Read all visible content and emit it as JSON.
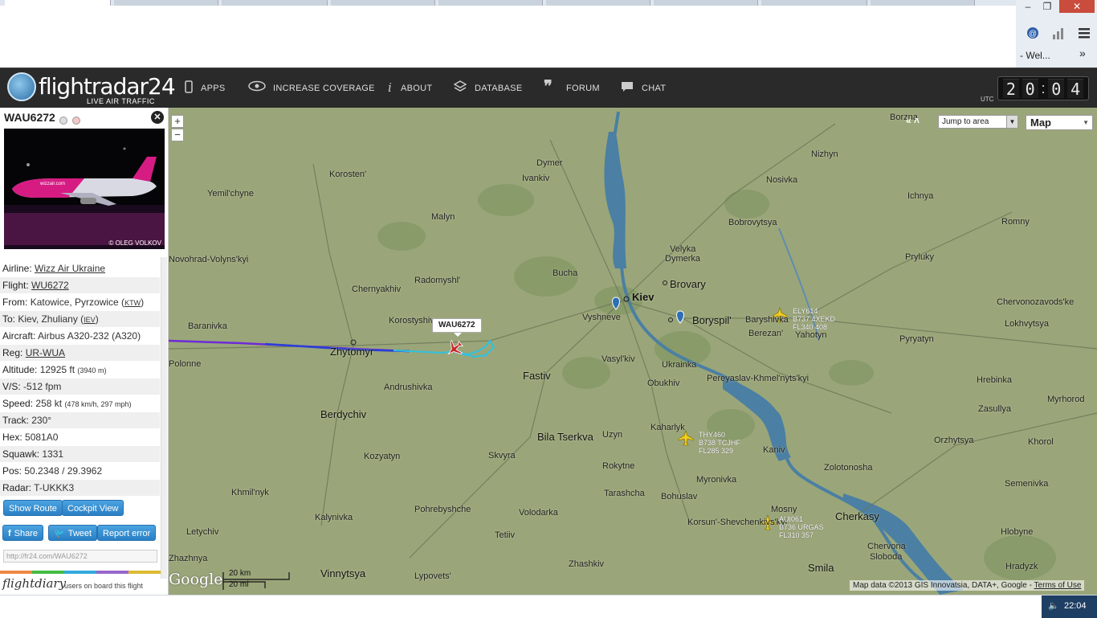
{
  "browser": {
    "bookmark_text": "- Wel...",
    "more": "»",
    "win_min": "–",
    "win_restore": "❐",
    "win_close": "✕"
  },
  "header": {
    "logo": "flightradar24",
    "tagline": "LIVE AIR TRAFFIC",
    "nav": [
      {
        "label": "APPS",
        "icon": "phone-icon"
      },
      {
        "label": "INCREASE COVERAGE",
        "icon": "eye-icon"
      },
      {
        "label": "ABOUT",
        "icon": "info-icon"
      },
      {
        "label": "DATABASE",
        "icon": "database-icon"
      },
      {
        "label": "FORUM",
        "icon": "quote-icon"
      },
      {
        "label": "CHAT",
        "icon": "chat-icon"
      }
    ],
    "utc_label": "UTC",
    "clock": {
      "h1": "2",
      "h2": "0",
      "sep": ":",
      "m1": "0",
      "m2": "4"
    }
  },
  "panel": {
    "title": "WAU6272",
    "close": "✕",
    "photo_credit": "© OLEG VOLKOV",
    "rows": [
      {
        "key": "Airline:",
        "value": "Wizz Air Ukraine"
      },
      {
        "key": "Flight:",
        "value": "WU6272"
      },
      {
        "key": "From:",
        "value": "Katowice, Pyrzowice (",
        "code": "KTW",
        "tail": ")"
      },
      {
        "key": "To:",
        "value": "Kiev, Zhuliany (",
        "code": "IEV",
        "tail": ")"
      },
      {
        "key": "Aircraft:",
        "value": "Airbus A320-232 (A320)"
      },
      {
        "key": "Reg:",
        "value": "UR-WUA"
      },
      {
        "key": "Altitude:",
        "value": "12925 ft",
        "small": "(3940 m)"
      },
      {
        "key": "V/S:",
        "value": "-512 fpm"
      },
      {
        "key": "Speed:",
        "value": "258 kt",
        "small": "(478 km/h, 297 mph)"
      },
      {
        "key": "Track:",
        "value": "230°"
      },
      {
        "key": "Hex:",
        "value": "5081A0"
      },
      {
        "key": "Squawk:",
        "value": "1331"
      },
      {
        "key": "Pos:",
        "value": "50.2348 / 29.3962"
      },
      {
        "key": "Radar:",
        "value": "T-UKKK3"
      }
    ],
    "buttons": {
      "show_route": "Show Route",
      "cockpit_view": "Cockpit View",
      "share": "Share",
      "tweet": "Tweet",
      "report_error": "Report error"
    },
    "link": "http://fr24.com/WAU6272",
    "diary_logo": "flightdiary",
    "diary_text": "users on board this flight"
  },
  "map": {
    "jump_to_area": "Jump to area",
    "map_type": "Map",
    "zoom_in": "+",
    "zoom_out": "−",
    "collapse": "« ˄",
    "callout": "WAU6272",
    "google": "Google",
    "scale_km": "20 km",
    "scale_mi": "20 mi",
    "attribution": "Map data ©2013 GIS Innovatsia, DATA+, Google - ",
    "terms": "Terms of Use",
    "places": [
      "Borzna",
      "Korosten'",
      "Dymer",
      "Ivankiv",
      "Nizhyn",
      "Nosivka",
      "Yemil'chyne",
      "Ichnya",
      "Malyn",
      "Bobrovytsya",
      "Romny",
      "Novohrad-Volyns'kyi",
      "Velyka",
      "Dymerka",
      "Pryluky",
      "Chernyakhiv",
      "Radomyshl'",
      "Bucha",
      "Brovary",
      "Chervonozavods'ke",
      "Kiev",
      "Vyshneve",
      "Boryspil'",
      "Baryshivka",
      "Lokhvytsya",
      "Baranivka",
      "Korostyshiv",
      "Berezan'",
      "Yahotyn",
      "Zhytomyr",
      "Pyryatyn",
      "Polonne",
      "Vasyl'kiv",
      "Fastiv",
      "Ukrainka",
      "Andrushivka",
      "Obukhiv",
      "Pereyaslav-Khmel'nyts'kyi",
      "Hrebinka",
      "Myrhorod",
      "Berdychiv",
      "Bila Tserkva",
      "Uzyn",
      "Kaharlyk",
      "Zasullya",
      "Orzhytsya",
      "Khorol",
      "Kozyatyn",
      "Skvyra",
      "Rokytne",
      "Kaniv",
      "Zolotonosha",
      "Khmil'nyk",
      "Myronivka",
      "Tarashcha",
      "Bohuslav",
      "Semenivka",
      "Pohrebyshche",
      "Kalynivka",
      "Volodarka",
      "Korsun'-Shevchenkivs'kyi",
      "Mosny",
      "Cherkasy",
      "Letychiv",
      "Tetiiv",
      "Chervona",
      "Sloboda",
      "Hlobyne",
      "Vinnytsya",
      "Lypovets'",
      "Zhashkiv",
      "Smila",
      "Hradyzk",
      "Khmil'nyk",
      "Zhazhnya",
      "Velyka"
    ],
    "aircraft": [
      {
        "callsign": "ELY614",
        "type_reg": "B737 4XEKD",
        "fl": "FL340 408"
      },
      {
        "callsign": "THY460",
        "type_reg": "B738 TCJHF",
        "fl": "FL285 329"
      },
      {
        "callsign": "AUI061",
        "type_reg": "B736 URGAS",
        "fl": "FL310 357"
      }
    ]
  },
  "taskbar": {
    "time": "22:04",
    "volume": "🔈"
  },
  "colors": {
    "header_bg": "#2a2a2a",
    "map_bg": "#9aa679",
    "track_blue": "#2b3fd6",
    "track_cyan": "#2fc2e0",
    "tray_bg": "#1f3e63"
  }
}
